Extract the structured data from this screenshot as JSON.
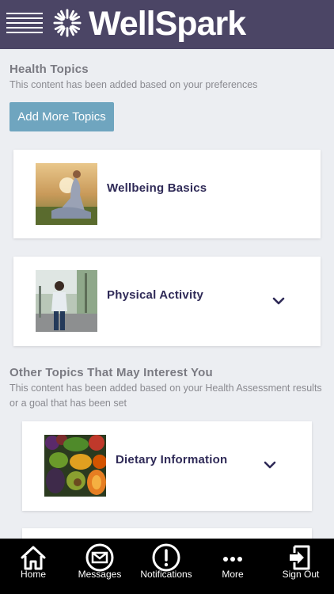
{
  "header": {
    "brand": "WellSpark",
    "trademark": "™"
  },
  "health_topics": {
    "title": "Health Topics",
    "subtitle": "This content has been added based on your preferences",
    "add_button_label": "Add More Topics",
    "cards": [
      {
        "label": "Wellbeing Basics"
      },
      {
        "label": "Physical Activity"
      }
    ]
  },
  "other_topics": {
    "title": "Other Topics That May Interest You",
    "subtitle": "This content has been added based on your Health Assessment results or a goal that has been set",
    "cards": [
      {
        "label": "Dietary Information"
      }
    ]
  },
  "bottom_nav": [
    {
      "label": "Home",
      "icon": "home-icon"
    },
    {
      "label": "Messages",
      "icon": "envelope-icon"
    },
    {
      "label": "Notifications",
      "icon": "exclamation-icon"
    },
    {
      "label": "More",
      "icon": "ellipsis-icon"
    },
    {
      "label": "Sign Out",
      "icon": "sign-out-icon"
    }
  ],
  "colors": {
    "header_bg": "#4b4565",
    "button_bg": "#6fa5bf",
    "card_title": "#2f2a57",
    "page_bg": "#eceef2",
    "nav_bg": "#000000"
  }
}
